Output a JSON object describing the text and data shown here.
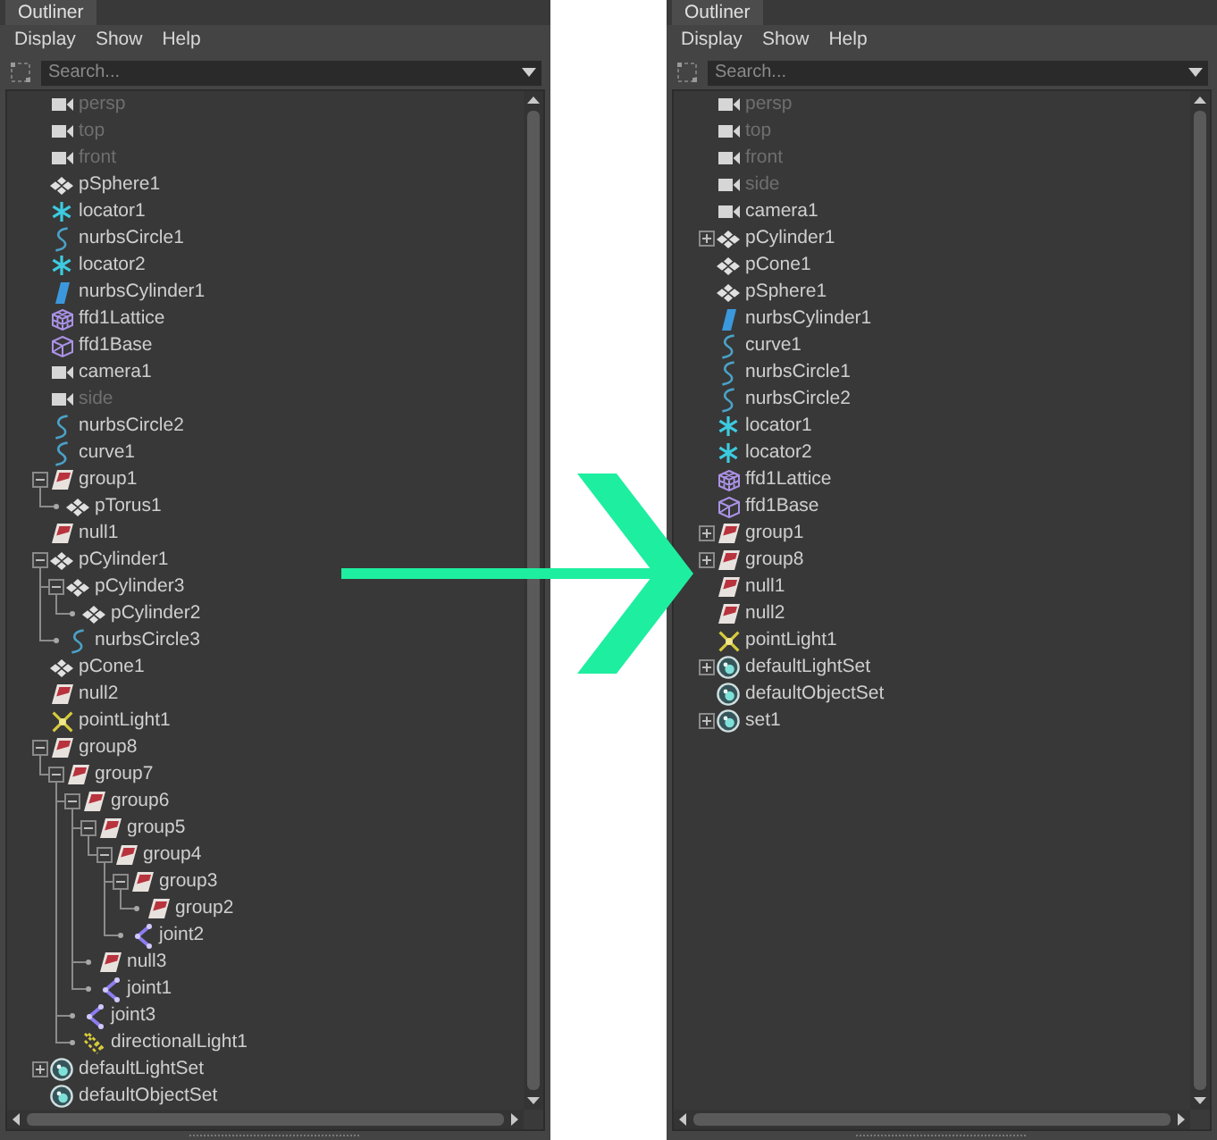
{
  "panels": [
    {
      "tab": {
        "label": "Outliner",
        "selected": true
      },
      "menu": [
        "Display",
        "Show",
        "Help"
      ],
      "search": {
        "placeholder": "Search..."
      },
      "tree": [
        {
          "label": "persp",
          "kind": "camera",
          "dimmed": true
        },
        {
          "label": "top",
          "kind": "camera",
          "dimmed": true
        },
        {
          "label": "front",
          "kind": "camera",
          "dimmed": true
        },
        {
          "label": "pSphere1",
          "kind": "mesh",
          "dimmed": false
        },
        {
          "label": "locator1",
          "kind": "locator",
          "dimmed": false
        },
        {
          "label": "nurbsCircle1",
          "kind": "curve",
          "dimmed": false
        },
        {
          "label": "locator2",
          "kind": "locator",
          "dimmed": false
        },
        {
          "label": "nurbsCylinder1",
          "kind": "surface",
          "dimmed": false
        },
        {
          "label": "ffd1Lattice",
          "kind": "lattice",
          "dimmed": false
        },
        {
          "label": "ffd1Base",
          "kind": "lattice_base",
          "dimmed": false
        },
        {
          "label": "camera1",
          "kind": "camera",
          "dimmed": false
        },
        {
          "label": "side",
          "kind": "camera",
          "dimmed": true
        },
        {
          "label": "nurbsCircle2",
          "kind": "curve",
          "dimmed": false
        },
        {
          "label": "curve1",
          "kind": "curve",
          "dimmed": false
        },
        {
          "label": "group1",
          "kind": "group",
          "dimmed": false,
          "expanded": true,
          "children": [
            {
              "label": "pTorus1",
              "kind": "mesh",
              "dimmed": false
            }
          ]
        },
        {
          "label": "null1",
          "kind": "group",
          "dimmed": false
        },
        {
          "label": "pCylinder1",
          "kind": "mesh",
          "dimmed": false,
          "expanded": true,
          "children": [
            {
              "label": "pCylinder3",
              "kind": "mesh",
              "dimmed": false,
              "expanded": true,
              "children": [
                {
                  "label": "pCylinder2",
                  "kind": "mesh",
                  "dimmed": false
                }
              ]
            },
            {
              "label": "nurbsCircle3",
              "kind": "curve",
              "dimmed": false
            }
          ]
        },
        {
          "label": "pCone1",
          "kind": "mesh",
          "dimmed": false
        },
        {
          "label": "null2",
          "kind": "group",
          "dimmed": false
        },
        {
          "label": "pointLight1",
          "kind": "point_light",
          "dimmed": false
        },
        {
          "label": "group8",
          "kind": "group",
          "dimmed": false,
          "expanded": true,
          "children": [
            {
              "label": "group7",
              "kind": "group",
              "dimmed": false,
              "expanded": true,
              "children": [
                {
                  "label": "group6",
                  "kind": "group",
                  "dimmed": false,
                  "expanded": true,
                  "children": [
                    {
                      "label": "group5",
                      "kind": "group",
                      "dimmed": false,
                      "expanded": true,
                      "children": [
                        {
                          "label": "group4",
                          "kind": "group",
                          "dimmed": false,
                          "expanded": true,
                          "children": [
                            {
                              "label": "group3",
                              "kind": "group",
                              "dimmed": false,
                              "expanded": true,
                              "children": [
                                {
                                  "label": "group2",
                                  "kind": "group",
                                  "dimmed": false
                                }
                              ]
                            },
                            {
                              "label": "joint2",
                              "kind": "joint",
                              "dimmed": false
                            }
                          ]
                        }
                      ]
                    },
                    {
                      "label": "null3",
                      "kind": "group",
                      "dimmed": false
                    },
                    {
                      "label": "joint1",
                      "kind": "joint",
                      "dimmed": false
                    }
                  ]
                },
                {
                  "label": "joint3",
                  "kind": "joint",
                  "dimmed": false
                },
                {
                  "label": "directionalLight1",
                  "kind": "directional_light",
                  "dimmed": false
                }
              ]
            }
          ]
        },
        {
          "label": "defaultLightSet",
          "kind": "set",
          "dimmed": false,
          "expanded": false
        },
        {
          "label": "defaultObjectSet",
          "kind": "set",
          "dimmed": false
        }
      ]
    },
    {
      "tab": {
        "label": "Outliner",
        "selected": true
      },
      "menu": [
        "Display",
        "Show",
        "Help"
      ],
      "search": {
        "placeholder": "Search..."
      },
      "tree": [
        {
          "label": "persp",
          "kind": "camera",
          "dimmed": true
        },
        {
          "label": "top",
          "kind": "camera",
          "dimmed": true
        },
        {
          "label": "front",
          "kind": "camera",
          "dimmed": true
        },
        {
          "label": "side",
          "kind": "camera",
          "dimmed": true
        },
        {
          "label": "camera1",
          "kind": "camera",
          "dimmed": false
        },
        {
          "label": "pCylinder1",
          "kind": "mesh",
          "dimmed": false,
          "expanded": false
        },
        {
          "label": "pCone1",
          "kind": "mesh",
          "dimmed": false
        },
        {
          "label": "pSphere1",
          "kind": "mesh",
          "dimmed": false
        },
        {
          "label": "nurbsCylinder1",
          "kind": "surface",
          "dimmed": false
        },
        {
          "label": "curve1",
          "kind": "curve",
          "dimmed": false
        },
        {
          "label": "nurbsCircle1",
          "kind": "curve",
          "dimmed": false
        },
        {
          "label": "nurbsCircle2",
          "kind": "curve",
          "dimmed": false
        },
        {
          "label": "locator1",
          "kind": "locator",
          "dimmed": false
        },
        {
          "label": "locator2",
          "kind": "locator",
          "dimmed": false
        },
        {
          "label": "ffd1Lattice",
          "kind": "lattice",
          "dimmed": false
        },
        {
          "label": "ffd1Base",
          "kind": "lattice_base",
          "dimmed": false
        },
        {
          "label": "group1",
          "kind": "group",
          "dimmed": false,
          "expanded": false
        },
        {
          "label": "group8",
          "kind": "group",
          "dimmed": false,
          "expanded": false
        },
        {
          "label": "null1",
          "kind": "group",
          "dimmed": false
        },
        {
          "label": "null2",
          "kind": "group",
          "dimmed": false
        },
        {
          "label": "pointLight1",
          "kind": "point_light",
          "dimmed": false
        },
        {
          "label": "defaultLightSet",
          "kind": "set",
          "dimmed": false,
          "expanded": false
        },
        {
          "label": "defaultObjectSet",
          "kind": "set",
          "dimmed": false
        },
        {
          "label": "set1",
          "kind": "set",
          "dimmed": false,
          "expanded": false
        }
      ]
    }
  ]
}
